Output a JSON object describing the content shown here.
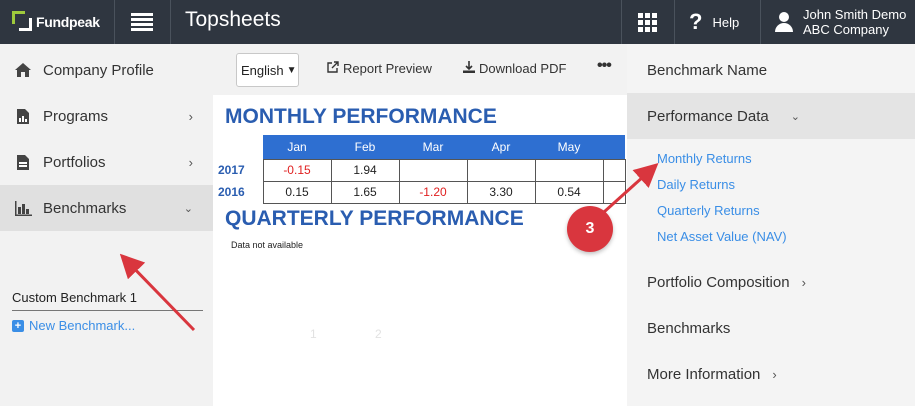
{
  "topbar": {
    "logo_text": "Fundpeak",
    "app_title": "Topsheets",
    "help_label": "Help",
    "user_name": "John Smith Demo",
    "company": "ABC Company"
  },
  "sidebar": {
    "items": [
      {
        "label": "Company Profile",
        "icon": "home-icon"
      },
      {
        "label": "Programs",
        "icon": "document-chart-icon"
      },
      {
        "label": "Portfolios",
        "icon": "folder-document-icon"
      },
      {
        "label": "Benchmarks",
        "icon": "bar-chart-icon"
      }
    ],
    "sub_items": {
      "custom": "Custom Benchmark 1",
      "new": "New Benchmark..."
    }
  },
  "toolbar": {
    "language": "English",
    "report_preview": "Report Preview",
    "download_pdf": "Download PDF",
    "more": "•••"
  },
  "report": {
    "monthly_title": "MONTHLY PERFORMANCE",
    "quarterly_title": "QUARTERLY PERFORMANCE",
    "quarterly_empty": "Data not available",
    "months": [
      "Jan",
      "Feb",
      "Mar",
      "Apr",
      "May",
      ""
    ],
    "rows": [
      {
        "year": "2017",
        "values": [
          "-0.15",
          "1.94",
          "",
          "",
          "",
          ""
        ]
      },
      {
        "year": "2016",
        "values": [
          "0.15",
          "1.65",
          "-1.20",
          "3.30",
          "0.54",
          ""
        ]
      }
    ],
    "ghost_1": "1",
    "ghost_2": "2"
  },
  "right_panel": {
    "items": [
      {
        "label": "Benchmark Name"
      },
      {
        "label": "Performance Data"
      },
      {
        "label": "Portfolio Composition"
      },
      {
        "label": "Benchmarks"
      },
      {
        "label": "More Information"
      }
    ],
    "links": [
      "Monthly Returns",
      "Daily Returns",
      "Quarterly Returns",
      "Net Asset Value (NAV)"
    ]
  },
  "annotation": {
    "step_number": "3",
    "color": "#d9363e"
  },
  "colors": {
    "topbar": "#2f3640",
    "accent_blue": "#2a5db0",
    "header_blue": "#2e6fd1",
    "link_blue": "#3a8ee6",
    "negative": "#e02020",
    "logo_green": "#9ec93c"
  }
}
